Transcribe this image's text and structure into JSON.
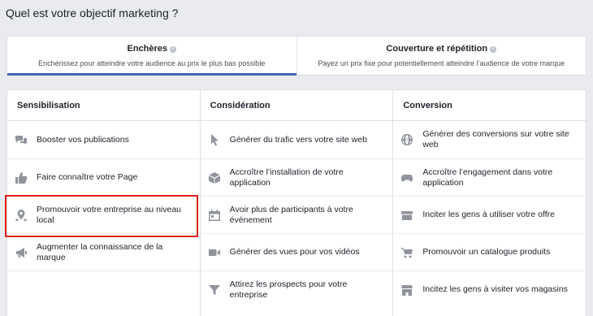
{
  "page": {
    "title": "Quel est votre objectif marketing ?"
  },
  "tabs": [
    {
      "title": "Enchères",
      "subtitle": "Enchérissez pour atteindre votre audience au prix le plus bas possible"
    },
    {
      "title": "Couverture et répétition",
      "subtitle": "Payez un prix fixe pour potentiellement atteindre l’audience de votre marque"
    }
  ],
  "info_glyph": "i",
  "columns": [
    {
      "title": "Sensibilisation",
      "items": [
        {
          "label": "Booster vos publications",
          "icon": "speech-bubbles-icon"
        },
        {
          "label": "Faire connaître votre Page",
          "icon": "thumbs-up-icon"
        },
        {
          "label": "Promouvoir votre entreprise au niveau local",
          "icon": "map-pin-icon"
        },
        {
          "label": "Augmenter la connaissance de la marque",
          "icon": "megaphone-icon"
        }
      ]
    },
    {
      "title": "Considération",
      "items": [
        {
          "label": "Générer du trafic vers votre site web",
          "icon": "cursor-icon"
        },
        {
          "label": "Accroître l’installation de votre application",
          "icon": "box-icon"
        },
        {
          "label": "Avoir plus de participants à votre évènement",
          "icon": "calendar-icon"
        },
        {
          "label": "Générer des vues pour vos vidéos",
          "icon": "video-camera-icon"
        },
        {
          "label": "Attirez les prospects pour votre entreprise",
          "icon": "funnel-icon"
        }
      ]
    },
    {
      "title": "Conversion",
      "items": [
        {
          "label": "Générer des conversions sur votre site web",
          "icon": "globe-icon"
        },
        {
          "label": "Accroître l’engagement dans votre application",
          "icon": "gamepad-icon"
        },
        {
          "label": "Inciter les gens à utiliser votre offre",
          "icon": "offer-icon"
        },
        {
          "label": "Promouvoir un catalogue produits",
          "icon": "shopping-cart-icon"
        },
        {
          "label": "Incitez les gens à visiter vos magasins",
          "icon": "store-icon"
        }
      ]
    }
  ],
  "colors": {
    "accent": "#4267b2",
    "highlight": "#e2231a",
    "icon": "#90949c"
  }
}
